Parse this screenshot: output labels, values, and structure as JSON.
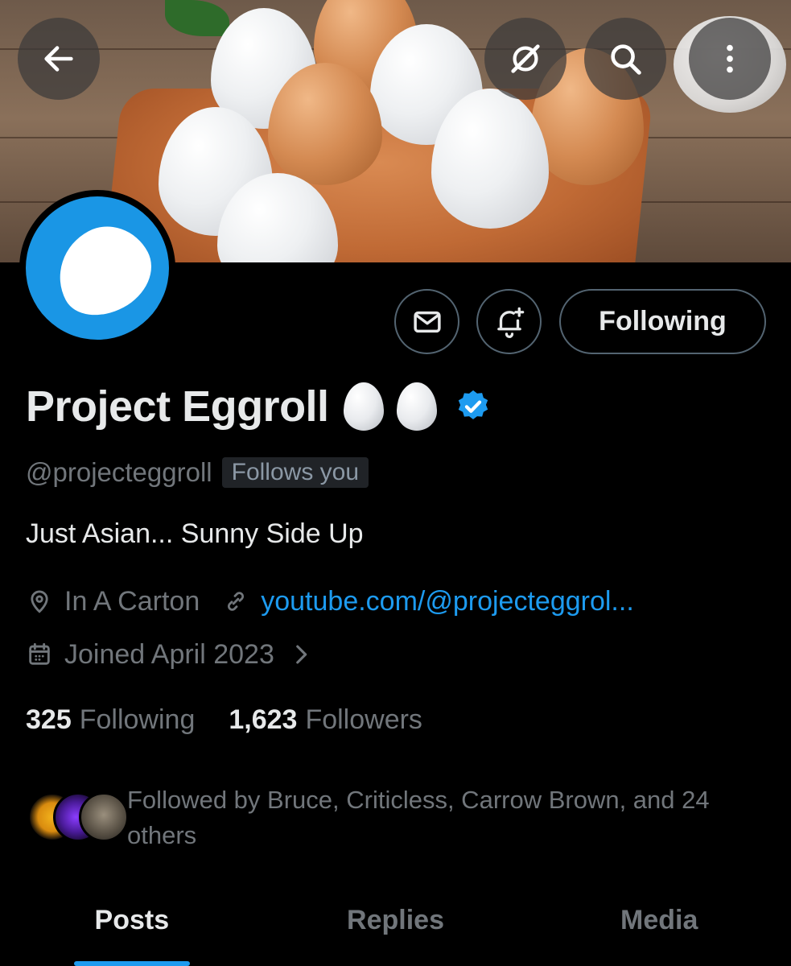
{
  "header": {
    "back_icon": "arrow-left-icon",
    "grok_icon": "grok-icon",
    "search_icon": "search-icon",
    "more_icon": "more-vertical-icon"
  },
  "profile": {
    "display_name": "Project Eggroll",
    "name_emoji": [
      "egg-emoji",
      "egg-emoji"
    ],
    "verified_icon": "verified-badge-icon",
    "handle": "@projecteggroll",
    "follows_you_badge": "Follows you",
    "bio": "Just Asian... Sunny Side Up",
    "location": "In A Carton",
    "website": "youtube.com/@projecteggrol...",
    "joined": "Joined April 2023"
  },
  "actions": {
    "message_icon": "mail-icon",
    "notify_icon": "bell-plus-icon",
    "following_label": "Following"
  },
  "stats": {
    "following_count": "325",
    "following_label": "Following",
    "followers_count": "1,623",
    "followers_label": "Followers"
  },
  "followed_by": {
    "text": "Followed by Bruce, Criticless, Carrow Brown, and 24 others"
  },
  "tabs": [
    {
      "label": "Posts",
      "active": true
    },
    {
      "label": "Replies",
      "active": false
    },
    {
      "label": "Media",
      "active": false
    }
  ],
  "colors": {
    "accent": "#1d9bf0",
    "secondary_text": "#71767b",
    "avatar_bg": "#1a96e5"
  }
}
